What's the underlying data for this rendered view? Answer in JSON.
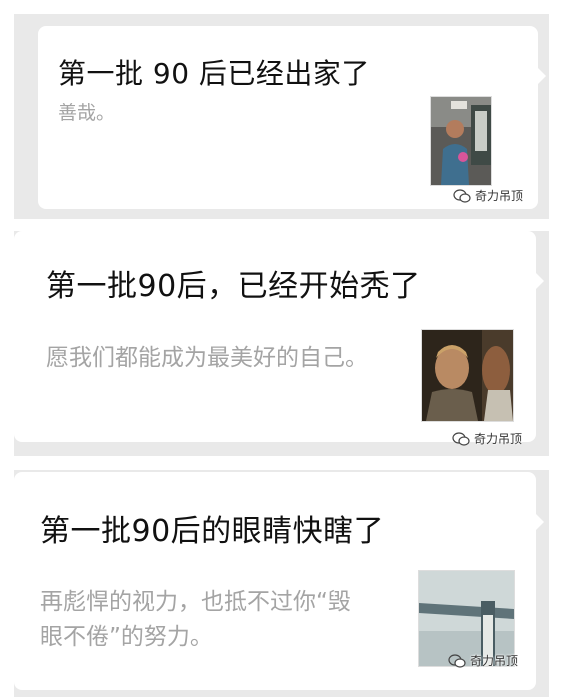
{
  "articles": [
    {
      "title": "第一批 90 后已经出家了",
      "summary": "善哉。"
    },
    {
      "title": "第一批90后，已经开始秃了",
      "summary": "愿我们都能成为最美好的自己。"
    },
    {
      "title": "第一批90后的眼睛快瞎了",
      "summary": "再彪悍的视力，也抵不过你“毁眼不倦”的努力。"
    }
  ],
  "watermark": "奇力吊顶",
  "icons": {
    "thumbnail": "photo-thumbnail",
    "watermark": "wechat-icon"
  },
  "colors": {
    "panel": "#e9e9e9",
    "title": "#111111",
    "summary": "#a4a4a4"
  }
}
